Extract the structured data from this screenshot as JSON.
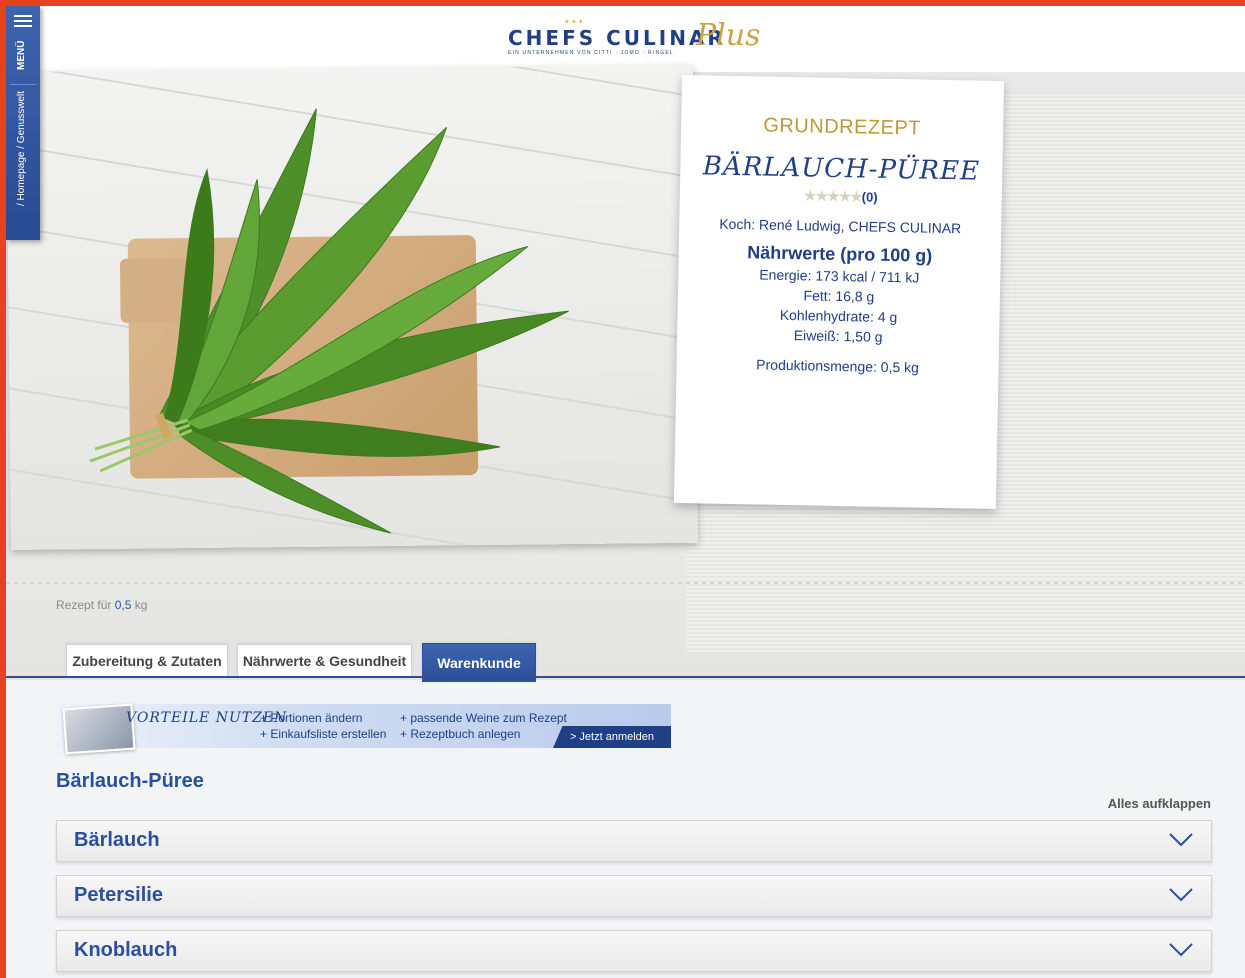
{
  "header": {
    "brand": "CHEFS CULINAR",
    "brand_tagline": "EIN UNTERNEHMEN VON CITTI · JOMO · RINGEL",
    "brand_plus": "Plus"
  },
  "side_menu": {
    "menu_label": "MENÜ",
    "breadcrumb": "/ Homepage / Genusswelt"
  },
  "recipe_card": {
    "type_label": "GRUNDREZEPT",
    "title": "BÄRLAUCH-PÜREE",
    "rating_stars": "★★★★★",
    "rating_count": "(0)",
    "cook": "Koch: René Ludwig, CHEFS CULINAR",
    "nutrition_title": "Nährwerte (pro 100 g)",
    "nutrition": [
      "Energie: 173 kcal / 711 kJ",
      "Fett: 16,8 g",
      "Kohlenhydrate: 4 g",
      "Eiweiß: 1,50 g"
    ],
    "production": "Produktionsmenge: 0,5 kg"
  },
  "recipe_for": {
    "label": "Rezept für",
    "value": "0,5",
    "unit": "kg"
  },
  "tabs": [
    {
      "label": "Zubereitung & Zutaten",
      "active": false
    },
    {
      "label": "Nährwerte & Gesundheit",
      "active": false
    },
    {
      "label": "Warenkunde",
      "active": true
    }
  ],
  "banner": {
    "title": "VORTEILE NUTZEN",
    "features": [
      "+ Portionen ändern",
      "+ Einkaufsliste erstellen",
      "+ passende Weine zum Rezept",
      "+ Rezeptbuch anlegen"
    ],
    "cta": "> Jetzt anmelden"
  },
  "section_title": "Bärlauch-Püree",
  "expand_all": "Alles aufklappen",
  "accordion": [
    {
      "label": "Bärlauch"
    },
    {
      "label": "Petersilie"
    },
    {
      "label": "Knoblauch"
    }
  ],
  "colors": {
    "frame": "#e3431f",
    "brand_blue": "#1f3f86",
    "gold": "#b99a3a"
  }
}
